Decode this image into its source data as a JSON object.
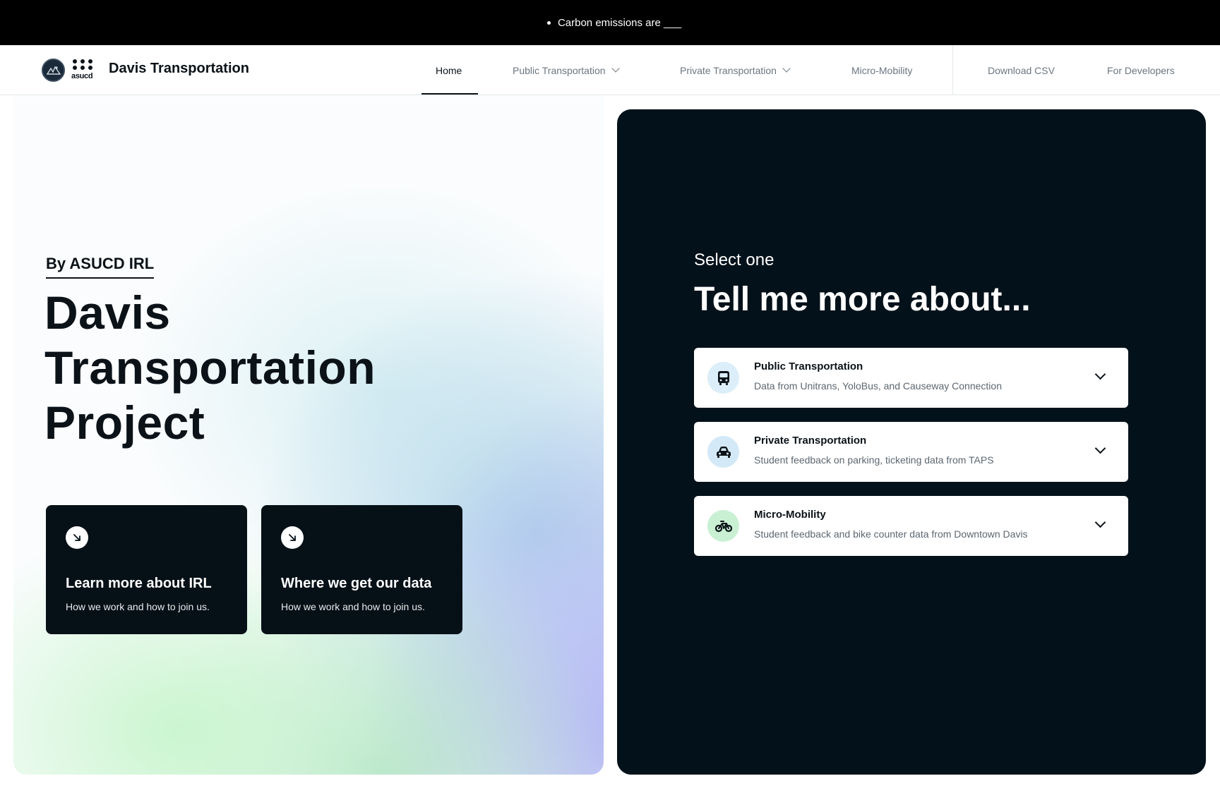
{
  "ticker": {
    "text": "Carbon emissions are ___"
  },
  "header": {
    "brand": "Davis Transportation",
    "logo_word": "asucd",
    "nav": [
      {
        "label": "Home",
        "active": true
      },
      {
        "label": "Public Transportation",
        "dropdown": true
      },
      {
        "label": "Private Transportation",
        "dropdown": true
      },
      {
        "label": "Micro-Mobility"
      },
      {
        "label": "Download CSV"
      },
      {
        "label": "For Developers"
      }
    ]
  },
  "hero": {
    "byline": "By ASUCD IRL",
    "title_lines": [
      "Davis",
      "Transportation",
      "Project"
    ],
    "cards": [
      {
        "title": "Learn more about IRL",
        "subtitle": "How we work and how to join us.",
        "icon": "arrow-down-right-icon"
      },
      {
        "title": "Where we get our data",
        "subtitle": "How we work and how to join us.",
        "icon": "arrow-down-right-icon"
      }
    ]
  },
  "panel": {
    "kicker": "Select one",
    "title": "Tell me more about...",
    "options": [
      {
        "title": "Public Transportation",
        "description": "Data from Unitrans, YoloBus, and Causeway Connection",
        "icon": "bus-icon",
        "icon_bg": "#dbeef9"
      },
      {
        "title": "Private Transportation",
        "description": "Student feedback on parking, ticketing data from TAPS",
        "icon": "car-icon",
        "icon_bg": "#d4e9f7"
      },
      {
        "title": "Micro-Mobility",
        "description": "Student feedback and bike counter data from Downtown Davis",
        "icon": "bike-icon",
        "icon_bg": "#c9f0d3"
      }
    ]
  },
  "colors": {
    "dark": "#03111a",
    "card": "#061017",
    "ink": "#0b1218",
    "muted": "#6b7680"
  }
}
